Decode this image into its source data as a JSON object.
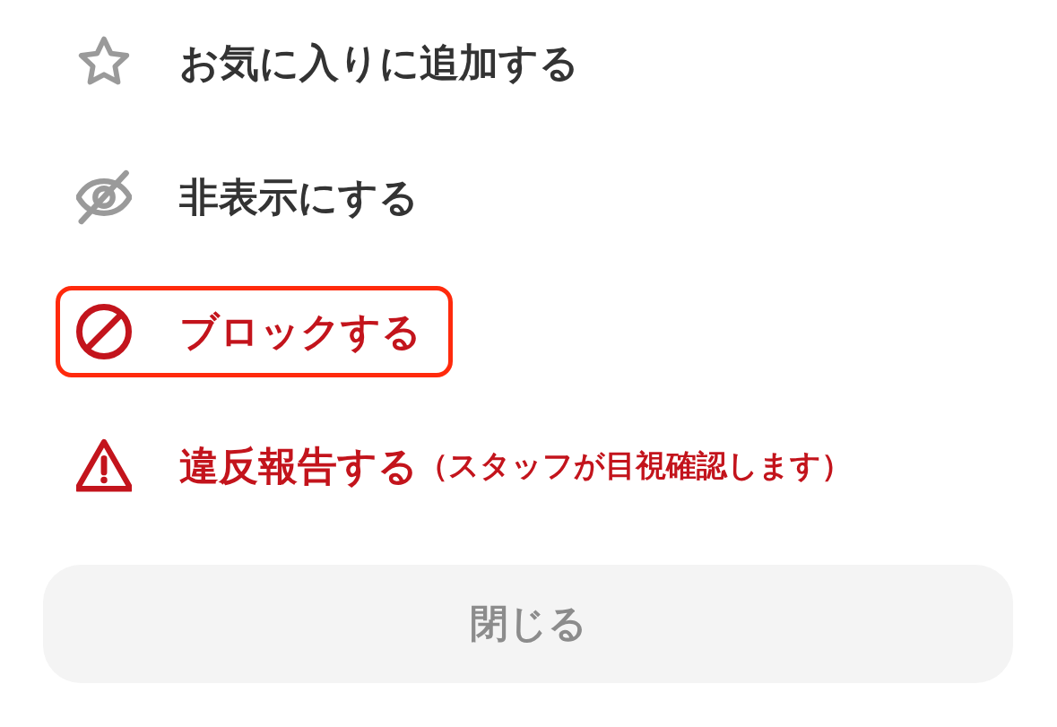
{
  "menu_items": [
    {
      "kind": "star",
      "label": "お気に入りに追加する",
      "danger": false,
      "highlighted": false
    },
    {
      "kind": "hide",
      "label": "非表示にする",
      "danger": false,
      "highlighted": false
    },
    {
      "kind": "block",
      "label": "ブロックする",
      "danger": true,
      "highlighted": true
    },
    {
      "kind": "report",
      "label": "違反報告する",
      "note": "（スタッフが目視確認します）",
      "danger": true,
      "highlighted": false
    }
  ],
  "close_button": {
    "label": "閉じる"
  }
}
